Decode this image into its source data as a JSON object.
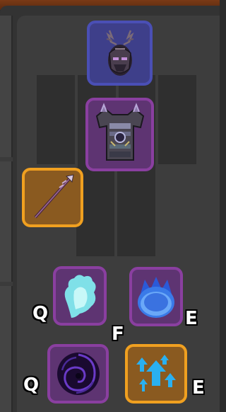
{
  "equipment": {
    "helmet": {
      "icon": "antlered-helmet-icon",
      "rarity_color": "#4a4fb5"
    },
    "chestplate": {
      "icon": "armor-chestplate-icon",
      "rarity_color": "#8a3fa0"
    },
    "weapon": {
      "icon": "spear-icon",
      "rarity_color": "#f0a020"
    }
  },
  "abilities": {
    "row1": [
      {
        "icon": "cyan-wisp-icon",
        "key": "Q",
        "rarity_color": "#8a3fa0"
      },
      {
        "icon": "blue-flame-orb-icon",
        "key": "E",
        "rarity_color": "#8a3fa0"
      }
    ],
    "center_key": "F",
    "row2": [
      {
        "icon": "dark-vortex-icon",
        "key": "Q",
        "rarity_color": "#8a3fa0"
      },
      {
        "icon": "blue-up-arrows-icon",
        "key": "E",
        "rarity_color": "#f0a020"
      }
    ]
  }
}
